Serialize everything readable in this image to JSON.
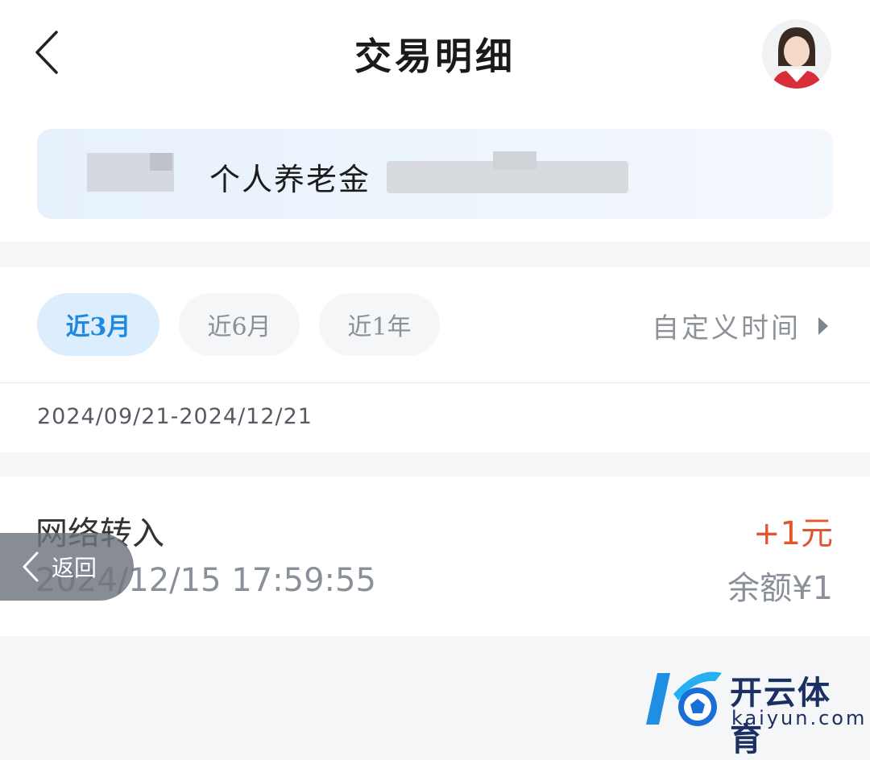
{
  "header": {
    "title": "交易明细"
  },
  "account": {
    "name": "个人养老金"
  },
  "filters": {
    "chips": [
      {
        "label": "近3月",
        "active": true
      },
      {
        "label": "近6月",
        "active": false
      },
      {
        "label": "近1年",
        "active": false
      }
    ],
    "custom_label": "自定义时间",
    "date_range": "2024/09/21-2024/12/21"
  },
  "transactions": [
    {
      "type": "网络转入",
      "time": "2024/12/15 17:59:55",
      "amount": "+1元",
      "balance": "余额¥1"
    }
  ],
  "floating_back": {
    "label": "返回"
  },
  "watermark": {
    "brand": "开云体育",
    "url": "kaiyun.com"
  },
  "colors": {
    "accent": "#1f89de",
    "amount_positive": "#e2562d",
    "muted": "#8a9099"
  }
}
